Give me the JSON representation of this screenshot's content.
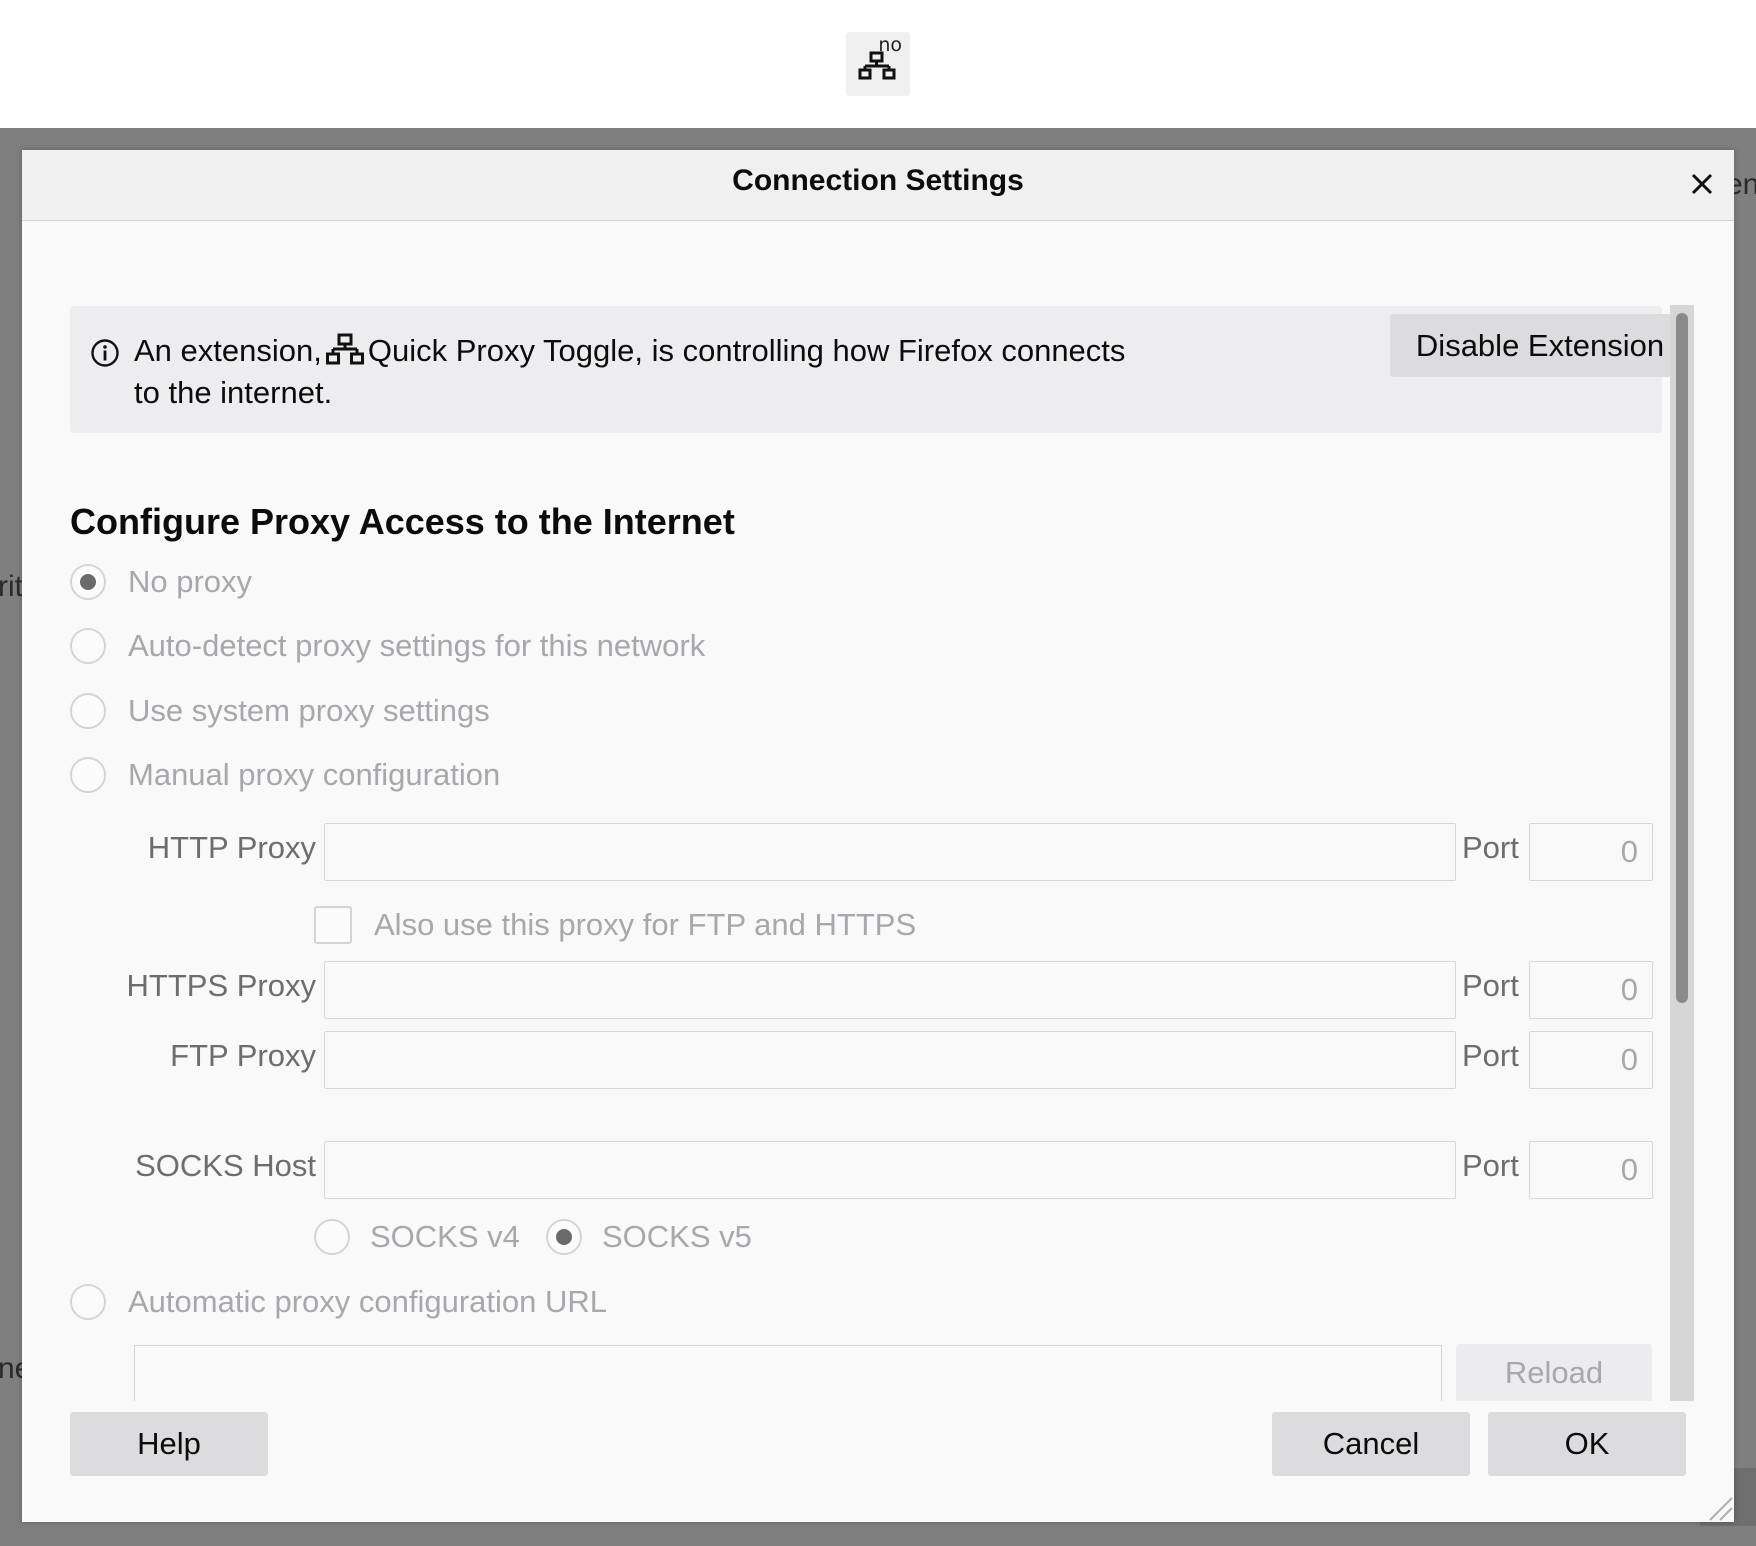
{
  "toolbar": {
    "extension_badge": "no",
    "extension_icon": "network-icon"
  },
  "background": {
    "fragment_top_right": "en",
    "fragment_left_middle": "rit",
    "fragment_left_bottom": "ne"
  },
  "dialog": {
    "title": "Connection Settings",
    "close_icon": "close-icon"
  },
  "notice": {
    "text_before": "An extension,",
    "extension_name": "Quick Proxy Toggle",
    "text_after": ", is controlling how Firefox connects to the internet.",
    "disable_button": "Disable Extension"
  },
  "proxy": {
    "section_title": "Configure Proxy Access to the Internet",
    "options": {
      "no_proxy": "No proxy",
      "auto_detect": "Auto-detect proxy settings for this network",
      "system": "Use system proxy settings",
      "manual": "Manual proxy configuration",
      "auto_url": "Automatic proxy configuration URL"
    },
    "selected": "No proxy",
    "http_label": "HTTP Proxy",
    "https_label": "HTTPS Proxy",
    "ftp_label": "FTP Proxy",
    "socks_label": "SOCKS Host",
    "port_label": "Port",
    "http_port": "0",
    "https_port": "0",
    "ftp_port": "0",
    "socks_port": "0",
    "http_value": "",
    "https_value": "",
    "ftp_value": "",
    "socks_value": "",
    "also_use_label": "Also use this proxy for FTP and HTTPS",
    "socks_v4": "SOCKS v4",
    "socks_v5": "SOCKS v5",
    "socks_selected": "SOCKS v5",
    "pac_url": "",
    "reload_button": "Reload"
  },
  "footer": {
    "help": "Help",
    "cancel": "Cancel",
    "ok": "OK"
  }
}
